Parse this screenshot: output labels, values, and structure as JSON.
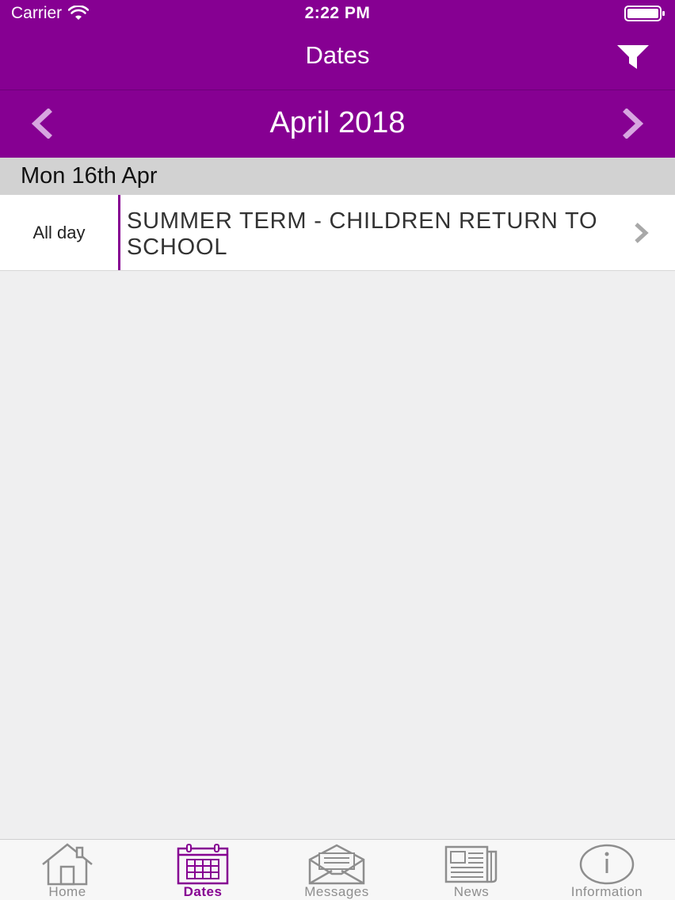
{
  "status_bar": {
    "carrier": "Carrier",
    "time": "2:22 PM"
  },
  "nav": {
    "title": "Dates",
    "filter_icon": "filter-icon"
  },
  "month_nav": {
    "month": "April 2018",
    "prev_icon": "chevron-left-icon",
    "next_icon": "chevron-right-icon"
  },
  "sections": [
    {
      "date": "Mon 16th Apr",
      "events": [
        {
          "time": "All day",
          "title": "SUMMER TERM - CHILDREN RETURN TO SCHOOL"
        }
      ]
    }
  ],
  "tabs": [
    {
      "label": "Home",
      "icon": "home-icon",
      "active": false
    },
    {
      "label": "Dates",
      "icon": "calendar-icon",
      "active": true
    },
    {
      "label": "Messages",
      "icon": "envelope-icon",
      "active": false
    },
    {
      "label": "News",
      "icon": "newspaper-icon",
      "active": false
    },
    {
      "label": "Information",
      "icon": "info-icon",
      "active": false
    }
  ],
  "colors": {
    "brand": "#860092",
    "background": "#efeff0",
    "section_header": "#d2d2d2",
    "tab_inactive": "#8e8e8e"
  }
}
